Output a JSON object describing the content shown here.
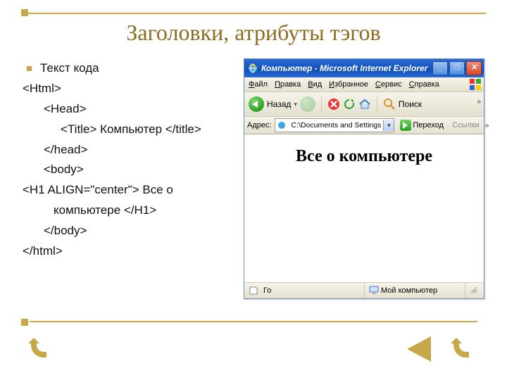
{
  "slide": {
    "title": "Заголовки, атрибуты тэгов"
  },
  "code": {
    "heading": "Текст кода",
    "lines": {
      "l0": "<Html>",
      "l1": "<Head>",
      "l2": "<Title> Компьютер </title>",
      "l3": "</head>",
      "l4": "<body>",
      "l5a": "<H1 ALIGN=\"center\"> Все о",
      "l5b": "компьютере </H1>",
      "l6": "</body>",
      "l7": "</html>"
    }
  },
  "ie": {
    "title": "Компьютер - Microsoft Internet Explorer",
    "menu": {
      "file": "Файл",
      "edit": "Правка",
      "view": "Вид",
      "favorites": "Избранное",
      "tools": "Сервис",
      "help": "Справка"
    },
    "toolbar": {
      "back": "Назад",
      "search": "Поиск"
    },
    "address": {
      "label": "Адрес:",
      "value": "C:\\Documents and Settings",
      "go": "Переход",
      "links": "Ссылки"
    },
    "page": {
      "h1": "Все о компьютере"
    },
    "status": {
      "left": "Го",
      "zone": "Мой компьютер"
    },
    "chev": "»"
  }
}
